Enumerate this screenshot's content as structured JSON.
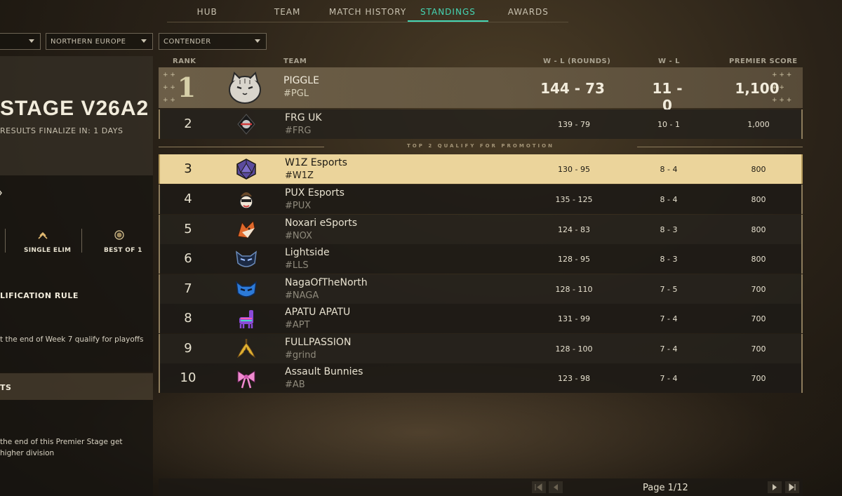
{
  "nav": {
    "tabs": [
      {
        "label": "HUB",
        "active": false
      },
      {
        "label": "TEAM",
        "active": false
      },
      {
        "label": "MATCH HISTORY",
        "active": false
      },
      {
        "label": "STANDINGS",
        "active": true
      },
      {
        "label": "AWARDS",
        "active": false
      }
    ],
    "accent": "#45d6b4"
  },
  "filters": {
    "region": "NORTHERN EUROPE",
    "division": "CONTENDER"
  },
  "stage": {
    "title": "STAGE V26A2",
    "finalize": "RESULTS FINALIZE IN: 1 DAYS"
  },
  "format": {
    "elim": "SINGLE ELIM",
    "bestof": "BEST OF 1"
  },
  "qualification": {
    "heading": "LIFICATION RULE",
    "text": "t the end of Week 7 qualify for playoffs"
  },
  "results": {
    "heading": "TS",
    "line1": "the end of this Premier Stage get",
    "line2": "higher division"
  },
  "table": {
    "headers": {
      "rank": "RANK",
      "team": "TEAM",
      "wl_rounds": "W - L (ROUNDS)",
      "wl": "W - L",
      "score": "PREMIER SCORE"
    },
    "promotion_note": "TOP 2 QUALIFY FOR PROMOTION",
    "rows": [
      {
        "rank": "1",
        "name": "PIGGLE",
        "tag": "#PGL",
        "wl_rounds": "144 - 73",
        "wl": "11 - 0",
        "score": "1,100",
        "logo": "cat-icon"
      },
      {
        "rank": "2",
        "name": "FRG UK",
        "tag": "#FRG",
        "wl_rounds": "139 - 79",
        "wl": "10 - 1",
        "score": "1,000",
        "logo": "frg-icon"
      },
      {
        "rank": "3",
        "name": "W1Z Esports",
        "tag": "#W1Z",
        "wl_rounds": "130 - 95",
        "wl": "8 - 4",
        "score": "800",
        "logo": "d20-icon"
      },
      {
        "rank": "4",
        "name": "PUX Esports",
        "tag": "#PUX",
        "wl_rounds": "135 - 125",
        "wl": "8 - 4",
        "score": "800",
        "logo": "pux-icon"
      },
      {
        "rank": "5",
        "name": "Noxari eSports",
        "tag": "#NOX",
        "wl_rounds": "124 - 83",
        "wl": "8 - 3",
        "score": "800",
        "logo": "fox-icon"
      },
      {
        "rank": "6",
        "name": "Lightside",
        "tag": "#LLS",
        "wl_rounds": "128 - 95",
        "wl": "8 - 3",
        "score": "800",
        "logo": "mask-icon"
      },
      {
        "rank": "7",
        "name": "NagaOfTheNorth",
        "tag": "#NAGA",
        "wl_rounds": "128 - 110",
        "wl": "7 - 5",
        "score": "700",
        "logo": "blue-mask-icon"
      },
      {
        "rank": "8",
        "name": "APATU APATU",
        "tag": "#APT",
        "wl_rounds": "131 - 99",
        "wl": "7 - 4",
        "score": "700",
        "logo": "llama-icon"
      },
      {
        "rank": "9",
        "name": "FULLPASSION",
        "tag": "#grind",
        "wl_rounds": "128 - 100",
        "wl": "7 - 4",
        "score": "700",
        "logo": "banana-icon"
      },
      {
        "rank": "10",
        "name": "Assault Bunnies",
        "tag": "#AB",
        "wl_rounds": "123 - 98",
        "wl": "7 - 4",
        "score": "700",
        "logo": "bow-icon"
      }
    ]
  },
  "pager": {
    "text": "Page 1/12"
  },
  "colors": {
    "highlight_row": "#ebd49b",
    "gold_border": "#8d7c5c"
  }
}
